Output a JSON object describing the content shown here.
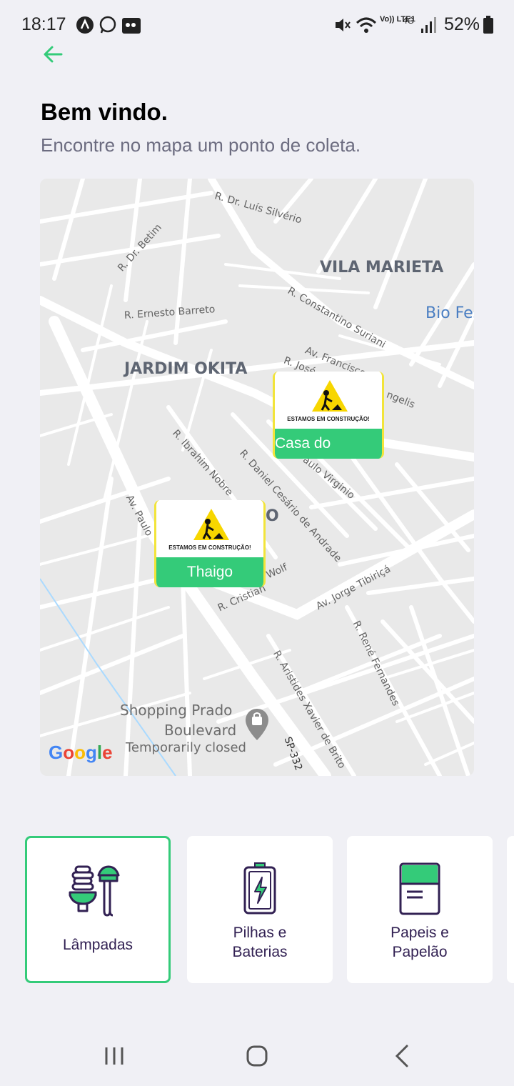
{
  "status_bar": {
    "time": "18:17",
    "battery": "52%",
    "network": "4G",
    "volte": "Vo)) LTE1"
  },
  "header": {
    "title": "Bem vindo.",
    "subtitle": "Encontre no mapa um ponto de coleta."
  },
  "map": {
    "areas": [
      "VILA MARIETA",
      "JARDIM OKITA"
    ],
    "partial_label": "Bio Fes",
    "stray_letter": "O",
    "streets": [
      "R. Dr. Luís Silvério",
      "R. Dr. Betim",
      "R. Ernesto Barreto",
      "R. Constantino Suriani",
      "Av. Francisco",
      "R. José",
      "ngelis",
      "R. Ibrahim Nobre",
      "R. Daniel Cesário de Andrade",
      "aulo Virginio",
      "Av. Paulo",
      "R. Cristian",
      "Wolf",
      "Av. Jorge Tibiriçá",
      "R. René Fernandes",
      "R. Aristides Xavier de Brito",
      "SP-332"
    ],
    "poi": {
      "name_line1": "Shopping Prado",
      "name_line2": "Boulevard",
      "status": "Temporarily closed"
    },
    "google_logo": "Google",
    "markers": [
      {
        "caption": "Casa do",
        "sign_text": "ESTAMOS EM CONSTRUÇÃO!"
      },
      {
        "caption": "Thaigo",
        "sign_text": "ESTAMOS EM CONSTRUÇÃO!"
      }
    ]
  },
  "items": [
    {
      "label_line1": "Lâmpadas",
      "label_line2": "",
      "icon": "lamp-icon",
      "selected": true
    },
    {
      "label_line1": "Pilhas e",
      "label_line2": "Baterias",
      "icon": "battery-icon",
      "selected": false
    },
    {
      "label_line1": "Papeis e",
      "label_line2": "Papelão",
      "icon": "paper-icon",
      "selected": false
    }
  ],
  "colors": {
    "accent_green": "#34cb79",
    "title_text": "#000000",
    "subtitle_text": "#6c6c80",
    "background": "#f0f0f5",
    "item_text": "#322153"
  }
}
